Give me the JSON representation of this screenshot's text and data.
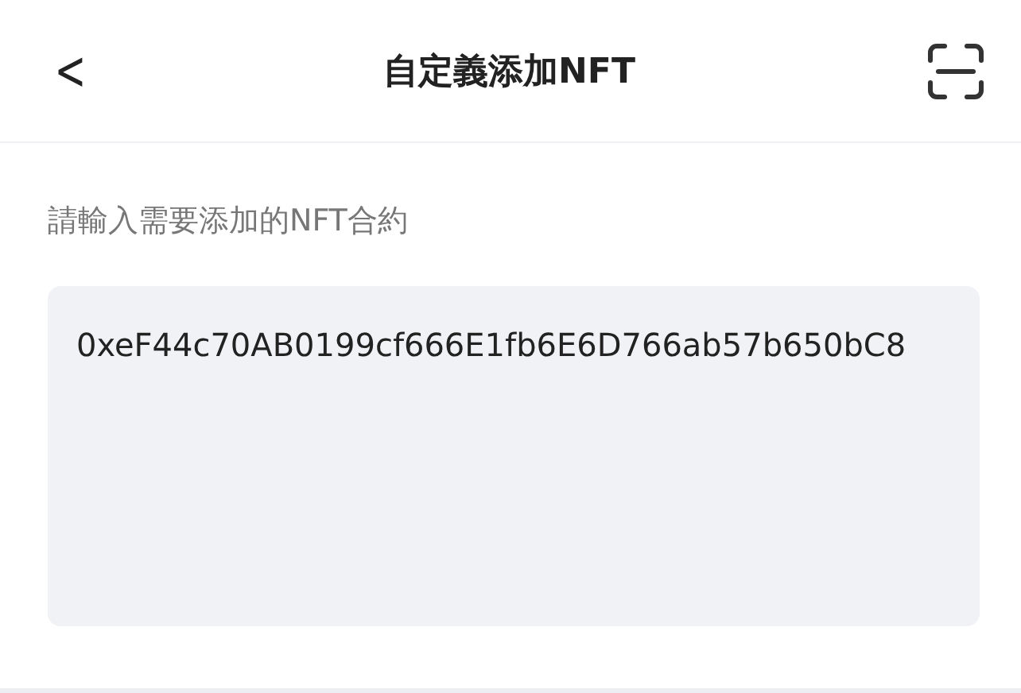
{
  "header": {
    "back": "<",
    "title": "自定義添加NFT"
  },
  "form": {
    "label": "請輸入需要添加的NFT合約",
    "value": "0xeF44c70AB0199cf666E1fb6E6D766ab57b650bC8"
  }
}
